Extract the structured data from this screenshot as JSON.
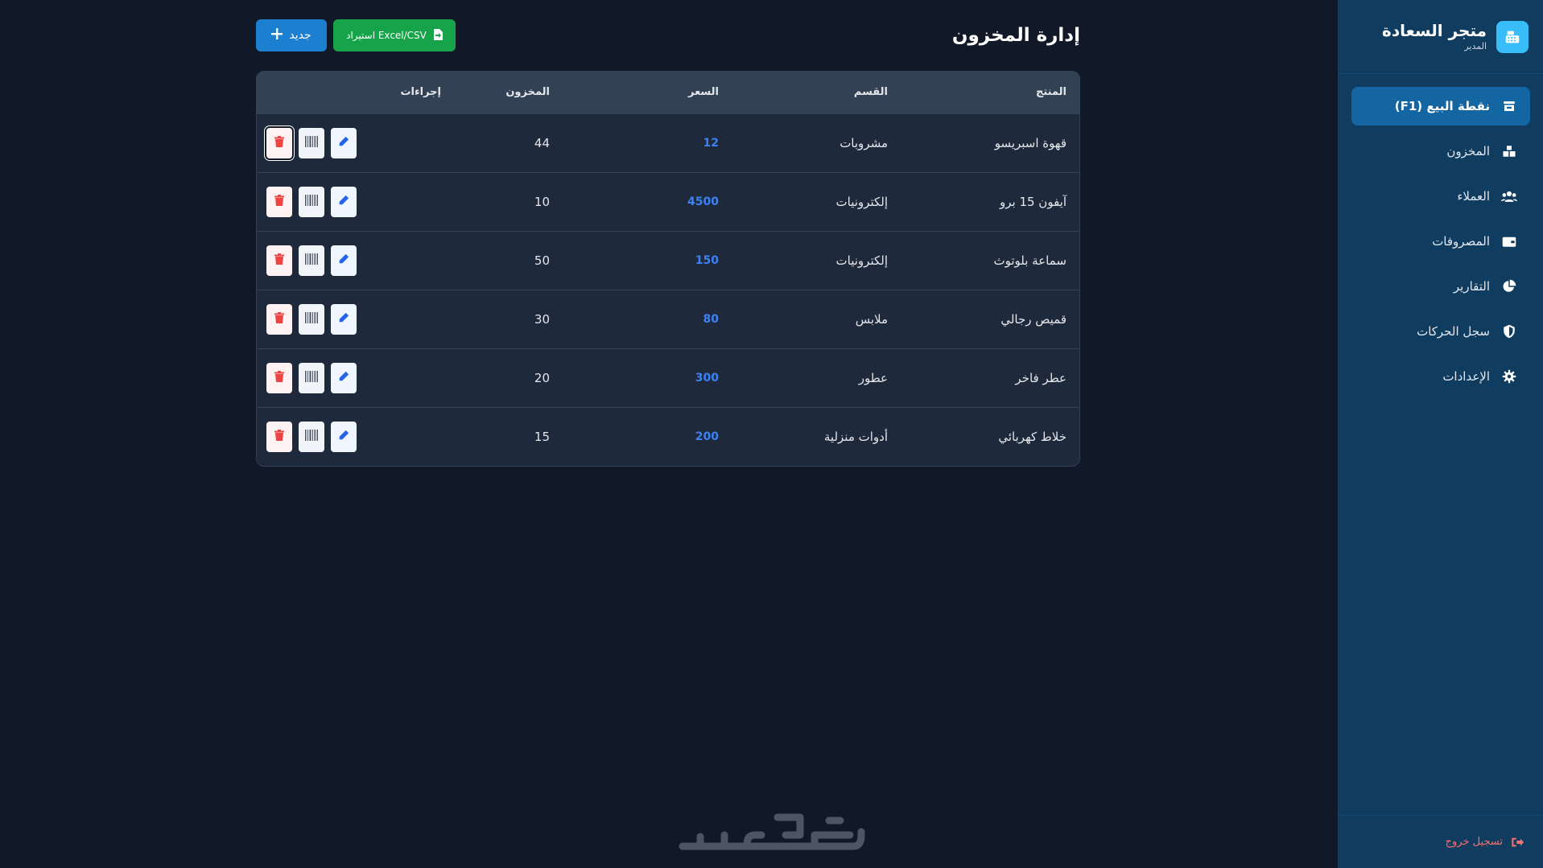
{
  "sidebar": {
    "brand_name": "متجر السعادة",
    "brand_role": "المدير",
    "items": [
      {
        "label": "نقطة البيع (F1)",
        "icon": "store-icon",
        "active": true
      },
      {
        "label": "المخزون",
        "icon": "boxes-icon",
        "active": false
      },
      {
        "label": "العملاء",
        "icon": "users-icon",
        "active": false
      },
      {
        "label": "المصروفات",
        "icon": "wallet-icon",
        "active": false
      },
      {
        "label": "التقارير",
        "icon": "pie-chart-icon",
        "active": false
      },
      {
        "label": "سجل الحركات",
        "icon": "shield-icon",
        "active": false
      },
      {
        "label": "الإعدادات",
        "icon": "gear-icon",
        "active": false
      }
    ],
    "logout_label": "تسجيل خروج"
  },
  "header": {
    "title": "إدارة المخزون",
    "import_label": "استيراد Excel/CSV",
    "new_label": "جديد"
  },
  "table": {
    "columns": {
      "product": "المنتج",
      "category": "القسم",
      "price": "السعر",
      "stock": "المخزون",
      "actions": "إجراءات"
    },
    "rows": [
      {
        "product": "قهوة اسبريسو",
        "category": "مشروبات",
        "price": "12",
        "stock": "44"
      },
      {
        "product": "آيفون 15 برو",
        "category": "إلكترونيات",
        "price": "4500",
        "stock": "10"
      },
      {
        "product": "سماعة بلوتوث",
        "category": "إلكترونيات",
        "price": "150",
        "stock": "50"
      },
      {
        "product": "قميص رجالي",
        "category": "ملابس",
        "price": "80",
        "stock": "30"
      },
      {
        "product": "عطر فاخر",
        "category": "عطور",
        "price": "300",
        "stock": "20"
      },
      {
        "product": "خلاط كهربائي",
        "category": "أدوات منزلية",
        "price": "200",
        "stock": "15"
      }
    ]
  },
  "watermark": "خمسات",
  "colors": {
    "background": "#111827",
    "sidebar": "#0f3c5f",
    "active_nav": "#1466a3",
    "new_button": "#1d7fd0",
    "import_button": "#16a34a",
    "price": "#3b82f6",
    "delete": "#ef4444"
  }
}
